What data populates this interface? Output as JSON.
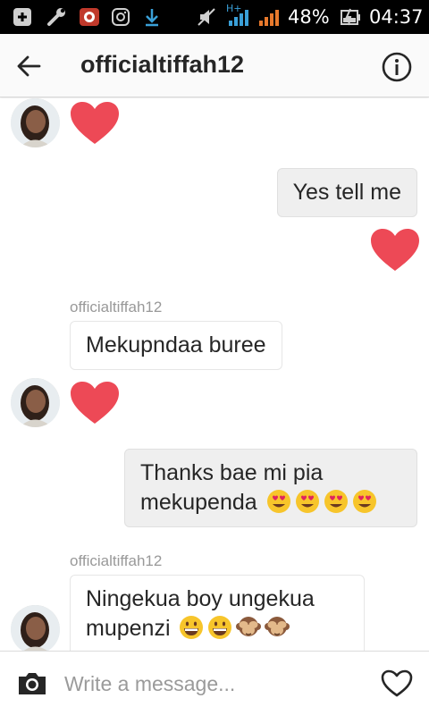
{
  "status_bar": {
    "network_type": "H+",
    "battery_percent": "48%",
    "time": "04:37",
    "icons": [
      "add-box-icon",
      "wrench-icon",
      "recorder-icon",
      "instagram-icon",
      "download-icon",
      "mute-icon",
      "signal-icon",
      "signal-icon-2",
      "battery-charging-icon"
    ]
  },
  "header": {
    "title": "officialtiffah12",
    "back_icon": "arrow-left-icon",
    "info_icon": "info-icon"
  },
  "messages": [
    {
      "type": "heart",
      "from": "them"
    },
    {
      "type": "text",
      "from": "me",
      "text": "Yes tell me"
    },
    {
      "type": "heart",
      "from": "me"
    },
    {
      "type": "text",
      "from": "them",
      "sender": "officialtiffah12",
      "text": "Mekupndaa buree"
    },
    {
      "type": "heart",
      "from": "them"
    },
    {
      "type": "text",
      "from": "me",
      "line1": "Thanks bae mi pia",
      "line2": "mekupenda",
      "emojis": [
        "heart-eyes",
        "heart-eyes",
        "heart-eyes",
        "heart-eyes"
      ]
    },
    {
      "type": "text",
      "from": "them",
      "sender": "officialtiffah12",
      "line1": "Ningekua boy ungekua",
      "line2": "mupenzi",
      "emojis": [
        "grin",
        "grin",
        "see-no-evil-monkey",
        "see-no-evil-monkey"
      ]
    }
  ],
  "composer": {
    "placeholder": "Write a message...",
    "camera_icon": "camera-icon",
    "like_icon": "heart-outline-icon"
  },
  "colors": {
    "heart": "#ed4956",
    "status_bar_bg": "#000000",
    "header_bg": "#fafafa",
    "outgoing_bubble": "#efefef",
    "sender_label": "#999999",
    "signal_orange": "#e8792c",
    "signal_blue": "#3aa0d8"
  }
}
